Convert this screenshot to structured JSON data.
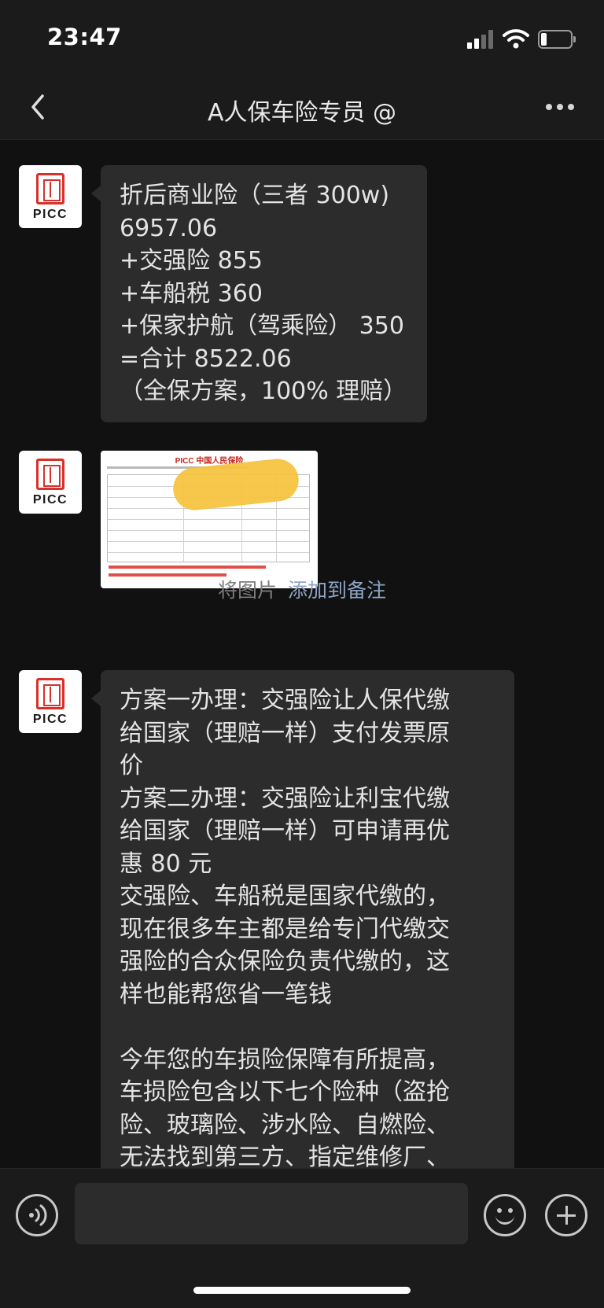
{
  "status_bar": {
    "time": "23:47",
    "icons": [
      "cellular-signal-icon",
      "wifi-icon",
      "battery-icon"
    ],
    "battery_level": 0.2
  },
  "nav": {
    "back_icon": "chevron-left-icon",
    "title": "A人保车险专员 @",
    "more_icon": "more-dots-icon"
  },
  "sender": {
    "avatar_logo": "PICC",
    "avatar_color": "#d8302a"
  },
  "messages": [
    {
      "type": "text",
      "lines": [
        "折后商业险（三者 300w)",
        "6957.06",
        "+交强险 855",
        "+车船税 360",
        "+保家护航（驾乘险） 350",
        "=合计 8522.06",
        "（全保方案，100% 理赔）"
      ]
    },
    {
      "type": "image",
      "header_text": "PICC 中国人民保险"
    },
    {
      "type": "text",
      "lines": [
        "方案一办理：交强险让人保代缴",
        "给国家（理赔一样）支付发票原",
        "价",
        "方案二办理：交强险让利宝代缴",
        "给国家（理赔一样）可申请再优",
        "惠 80 元",
        "交强险、车船税是国家代缴的，",
        "现在很多车主都是给专门代缴交",
        "强险的合众保险负责代缴的，这",
        "样也能帮您省一笔钱",
        "",
        "今年您的车损险保障有所提高，",
        "车损险包含以下七个险种（盗抢",
        "险、玻璃险、涉水险、自燃险、",
        "无法找到第三方、指定维修厂、"
      ]
    }
  ],
  "image_caption": {
    "label": "将图片",
    "link": "添加到备注"
  },
  "input_bar": {
    "voice_icon": "voice-icon",
    "emoji_icon": "emoji-icon",
    "plus_icon": "plus-icon",
    "input_value": ""
  }
}
